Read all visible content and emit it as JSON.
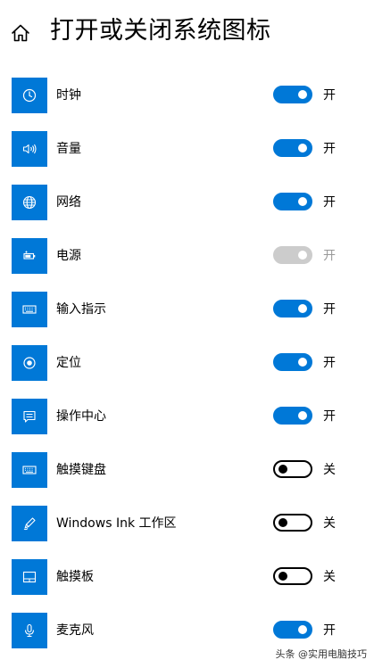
{
  "header": {
    "title": "打开或关闭系统图标",
    "home_icon": "home-icon"
  },
  "colors": {
    "accent": "#0078d7",
    "disabled": "#cccccc"
  },
  "items": [
    {
      "label": "时钟",
      "icon": "clock-icon",
      "state": "on",
      "state_label": "开"
    },
    {
      "label": "音量",
      "icon": "volume-icon",
      "state": "on",
      "state_label": "开"
    },
    {
      "label": "网络",
      "icon": "globe-icon",
      "state": "on",
      "state_label": "开"
    },
    {
      "label": "电源",
      "icon": "battery-icon",
      "state": "disabled",
      "state_label": "开"
    },
    {
      "label": "输入指示",
      "icon": "keyboard-icon",
      "state": "on",
      "state_label": "开"
    },
    {
      "label": "定位",
      "icon": "location-icon",
      "state": "on",
      "state_label": "开"
    },
    {
      "label": "操作中心",
      "icon": "action-center-icon",
      "state": "on",
      "state_label": "开"
    },
    {
      "label": "触摸键盘",
      "icon": "keyboard-icon",
      "state": "off",
      "state_label": "关"
    },
    {
      "label": "Windows Ink 工作区",
      "icon": "pen-icon",
      "state": "off",
      "state_label": "关"
    },
    {
      "label": "触摸板",
      "icon": "touchpad-icon",
      "state": "off",
      "state_label": "关"
    },
    {
      "label": "麦克风",
      "icon": "microphone-icon",
      "state": "on",
      "state_label": "开"
    }
  ],
  "watermark": "头条 @实用电脑技巧"
}
